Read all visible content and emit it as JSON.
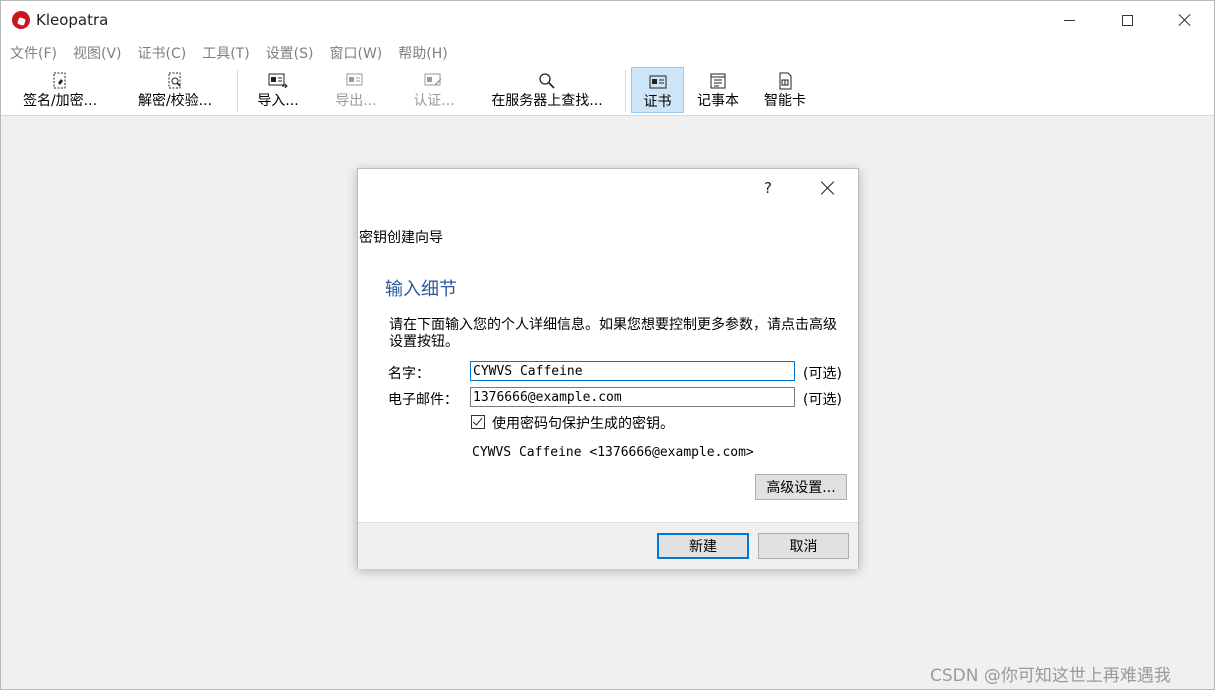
{
  "window": {
    "app_icon": "kleopatra-logo-icon",
    "title": "Kleopatra",
    "controls": [
      "minimize-icon",
      "maximize-icon",
      "close-icon"
    ]
  },
  "menubar": {
    "items": [
      {
        "label": "文件(F)"
      },
      {
        "label": "视图(V)"
      },
      {
        "label": "证书(C)"
      },
      {
        "label": "工具(T)"
      },
      {
        "label": "设置(S)"
      },
      {
        "label": "窗口(W)"
      },
      {
        "label": "帮助(H)"
      }
    ]
  },
  "toolbar": {
    "items": [
      {
        "label": "签名/加密...",
        "icon": "sign-encrypt-icon",
        "enabled": true
      },
      {
        "label": "解密/校验...",
        "icon": "decrypt-verify-icon",
        "enabled": true
      },
      {
        "label": "导入...",
        "icon": "import-icon",
        "enabled": true
      },
      {
        "label": "导出...",
        "icon": "export-icon",
        "enabled": false
      },
      {
        "label": "认证...",
        "icon": "certify-icon",
        "enabled": false
      },
      {
        "label": "在服务器上查找...",
        "icon": "search-icon",
        "enabled": true
      },
      {
        "label": "证书",
        "icon": "certificate-icon",
        "enabled": true,
        "active": true
      },
      {
        "label": "记事本",
        "icon": "notepad-icon",
        "enabled": true
      },
      {
        "label": "智能卡",
        "icon": "smartcard-icon",
        "enabled": true
      }
    ]
  },
  "dialog": {
    "help_label": "?",
    "wizard_title": "密钥创建向导",
    "heading": "输入细节",
    "description": "请在下面输入您的个人详细信息。如果您想要控制更多参数，请点击高级设置按钮。",
    "name_label": "名字：",
    "name_value": "CYWVS Caffeine",
    "name_optional": "(可选)",
    "email_label": "电子邮件：",
    "email_value": "1376666@example.com",
    "email_optional": "(可选)",
    "protect_checkbox_label": "使用密码句保护生成的密钥。",
    "protect_checked": true,
    "preview": "CYWVS Caffeine <1376666@example.com>",
    "advanced_button": "高级设置...",
    "create_button": "新建",
    "cancel_button": "取消"
  },
  "watermark": "CSDN @你可知这世上再难遇我",
  "colors": {
    "accent": "#0078d7",
    "heading": "#2a5a9a",
    "active_tool_bg": "#cde5f7"
  }
}
